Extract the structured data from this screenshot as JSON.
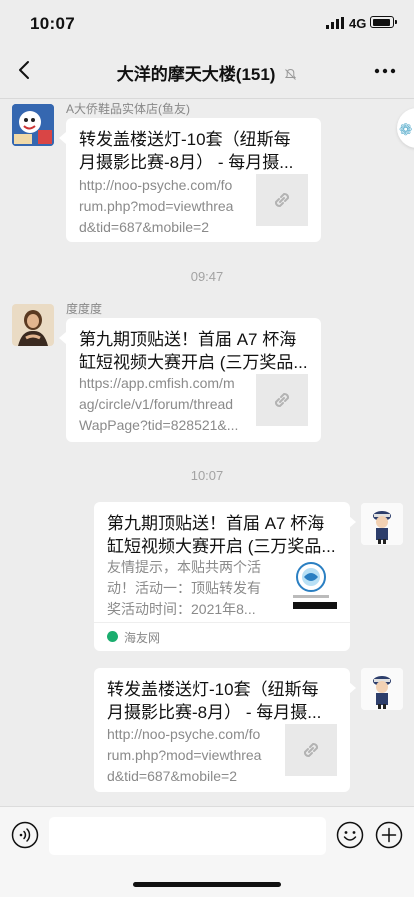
{
  "status": {
    "time": "10:07",
    "network": "4G"
  },
  "header": {
    "title": "大洋的摩天大楼(151)"
  },
  "messages": [
    {
      "sender": "A大侨鞋品实体店(鱼友)",
      "title": "转发盖楼送灯-10套（纽斯每月摄影比赛-8月） - 每月摄...",
      "title_line1": "转发盖楼送灯-10套（纽斯每",
      "title_line2": "月摄影比赛-8月） - 每月摄...",
      "desc_line1": "http://noo-psyche.com/fo",
      "desc_line2": "rum.php?mod=viewthrea",
      "desc_line3": "d&tid=687&mobile=2"
    },
    {
      "timestamp": "09:47",
      "sender": "度度度",
      "title_line1": "第九期顶贴送！首届 A7 杯海",
      "title_line2": "缸短视频大赛开启 (三万奖品...",
      "desc_line1": "https://app.cmfish.com/m",
      "desc_line2": "ag/circle/v1/forum/thread",
      "desc_line3": "WapPage?tid=828521&..."
    },
    {
      "timestamp": "10:07",
      "title_line1": "第九期顶贴送！首届 A7 杯海",
      "title_line2": "缸短视频大赛开启 (三万奖品...",
      "desc_line1": "友情提示，本贴共两个活",
      "desc_line2": "动！活动一：顶贴转发有",
      "desc_line3": "奖活动时间：2021年8...",
      "source": "海友网"
    },
    {
      "title_line1": "转发盖楼送灯-10套（纽斯每",
      "title_line2": "月摄影比赛-8月） - 每月摄...",
      "desc_line1": "http://noo-psyche.com/fo",
      "desc_line2": "rum.php?mod=viewthrea",
      "desc_line3": "d&tid=687&mobile=2"
    }
  ],
  "colors": {
    "background": "#ededed",
    "bubble": "#ffffff",
    "source_icon": "#1aad6e"
  },
  "icons": [
    "back-icon",
    "mute-icon",
    "more-icon",
    "link-icon",
    "voice-icon",
    "emoji-icon",
    "plus-icon"
  ]
}
